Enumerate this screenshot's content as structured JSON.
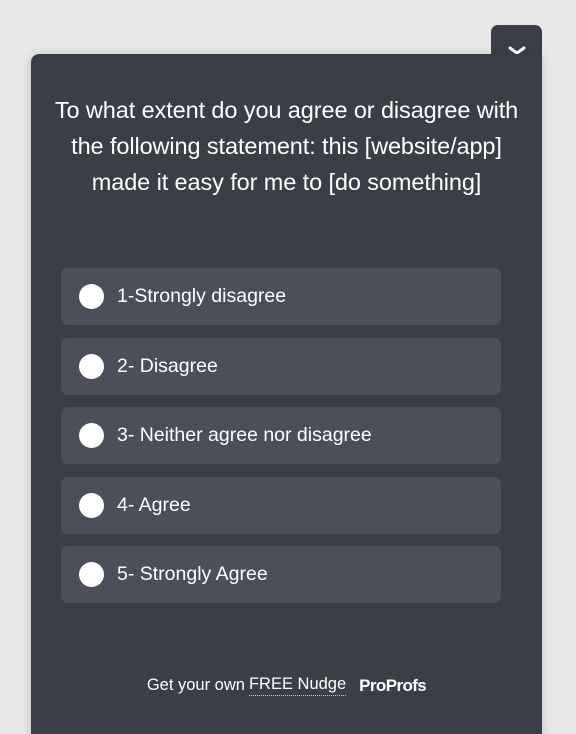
{
  "question": "To what extent do you agree or disagree with the following statement: this [website/app] made it easy for me to [do something]",
  "options": [
    {
      "label": "1-Strongly disagree"
    },
    {
      "label": "2- Disagree"
    },
    {
      "label": "3- Neither agree nor disagree"
    },
    {
      "label": "4- Agree"
    },
    {
      "label": "5- Strongly Agree"
    }
  ],
  "footer": {
    "prefix": "Get your own",
    "link_text": "FREE Nudge",
    "brand": "ProProfs"
  },
  "collapse_icon": "chevron-down-icon",
  "colors": {
    "page_background": "#e7e7e8",
    "panel": "#3a3e47",
    "option_background": "#4b4f5a",
    "text": "#ffffff"
  }
}
